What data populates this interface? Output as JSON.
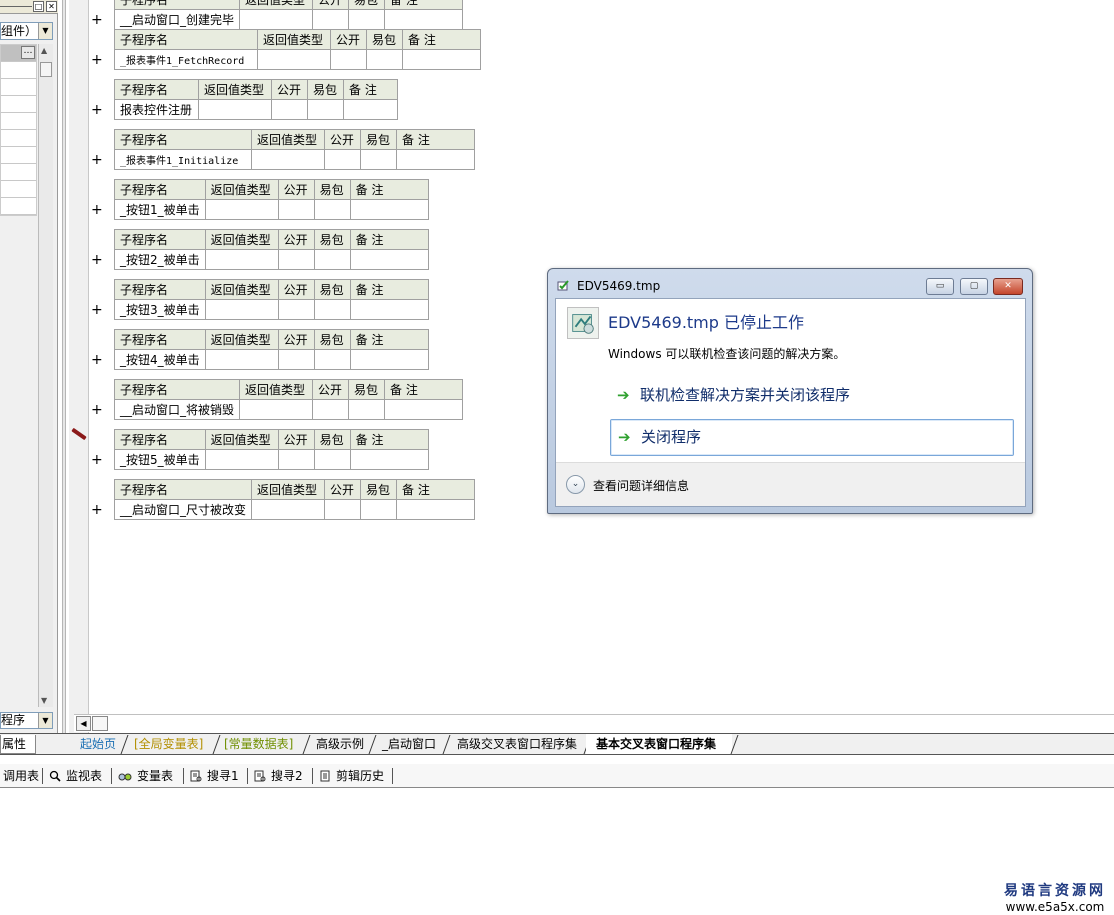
{
  "left_panel": {
    "component_combo": "组件）",
    "program_combo": "程序",
    "properties_tab": "属性",
    "dots_button": "…"
  },
  "code_tables": [
    {
      "header": [
        "子程序名",
        "返回值类型",
        "公开",
        "易包",
        "备 注"
      ],
      "name": "__启动窗口_创建完毕",
      "mono": false
    },
    {
      "header": [
        "子程序名",
        "返回值类型",
        "公开",
        "易包",
        "备 注"
      ],
      "name": "_报表事件1_FetchRecord",
      "mono": true
    },
    {
      "header": [
        "子程序名",
        "返回值类型",
        "公开",
        "易包",
        "备 注"
      ],
      "name": "报表控件注册",
      "mono": false
    },
    {
      "header": [
        "子程序名",
        "返回值类型",
        "公开",
        "易包",
        "备 注"
      ],
      "name": "_报表事件1_Initialize",
      "mono": true
    },
    {
      "header": [
        "子程序名",
        "返回值类型",
        "公开",
        "易包",
        "备 注"
      ],
      "name": "_按钮1_被单击",
      "mono": false
    },
    {
      "header": [
        "子程序名",
        "返回值类型",
        "公开",
        "易包",
        "备 注"
      ],
      "name": "_按钮2_被单击",
      "mono": false
    },
    {
      "header": [
        "子程序名",
        "返回值类型",
        "公开",
        "易包",
        "备 注"
      ],
      "name": "_按钮3_被单击",
      "mono": false
    },
    {
      "header": [
        "子程序名",
        "返回值类型",
        "公开",
        "易包",
        "备 注"
      ],
      "name": "_按钮4_被单击",
      "mono": false
    },
    {
      "header": [
        "子程序名",
        "返回值类型",
        "公开",
        "易包",
        "备 注"
      ],
      "name": "__启动窗口_将被销毁",
      "mono": false
    },
    {
      "header": [
        "子程序名",
        "返回值类型",
        "公开",
        "易包",
        "备 注"
      ],
      "name": "_按钮5_被单击",
      "mono": false
    },
    {
      "header": [
        "子程序名",
        "返回值类型",
        "公开",
        "易包",
        "备 注"
      ],
      "name": "__启动窗口_尺寸被改变",
      "mono": false
    }
  ],
  "expand_symbol": "+",
  "tabs": [
    {
      "label": "起始页",
      "color": "#1a6fb3"
    },
    {
      "label": "[全局变量表]",
      "color": "#b28f00"
    },
    {
      "label": "[常量数据表]",
      "color": "#6f8f00"
    },
    {
      "label": "高级示例",
      "color": "#000000"
    },
    {
      "label": "_启动窗口",
      "color": "#000000"
    },
    {
      "label": "高级交叉表窗口程序集",
      "color": "#000000"
    },
    {
      "label": "基本交叉表窗口程序集",
      "color": "#000000",
      "active": true
    }
  ],
  "toolbar": [
    {
      "label": "调用表",
      "icon": ""
    },
    {
      "label": "监视表",
      "icon": "magnifier-icon"
    },
    {
      "label": "变量表",
      "icon": "variables-icon"
    },
    {
      "label": "搜寻1",
      "icon": "search-list-icon"
    },
    {
      "label": "搜寻2",
      "icon": "search-list-icon"
    },
    {
      "label": "剪辑历史",
      "icon": "clipboard-icon"
    }
  ],
  "dialog": {
    "window_title": "EDV5469.tmp",
    "heading": "EDV5469.tmp 已停止工作",
    "subtext": "Windows 可以联机检查该问题的解决方案。",
    "option1": "联机检查解决方案并关闭该程序",
    "option2": "关闭程序",
    "details_label": "查看问题详细信息",
    "minimize": "▭",
    "maximize": "▢",
    "close": "✕"
  },
  "watermark": {
    "name": "易语言资源网",
    "url": "www.e5a5x.com"
  }
}
